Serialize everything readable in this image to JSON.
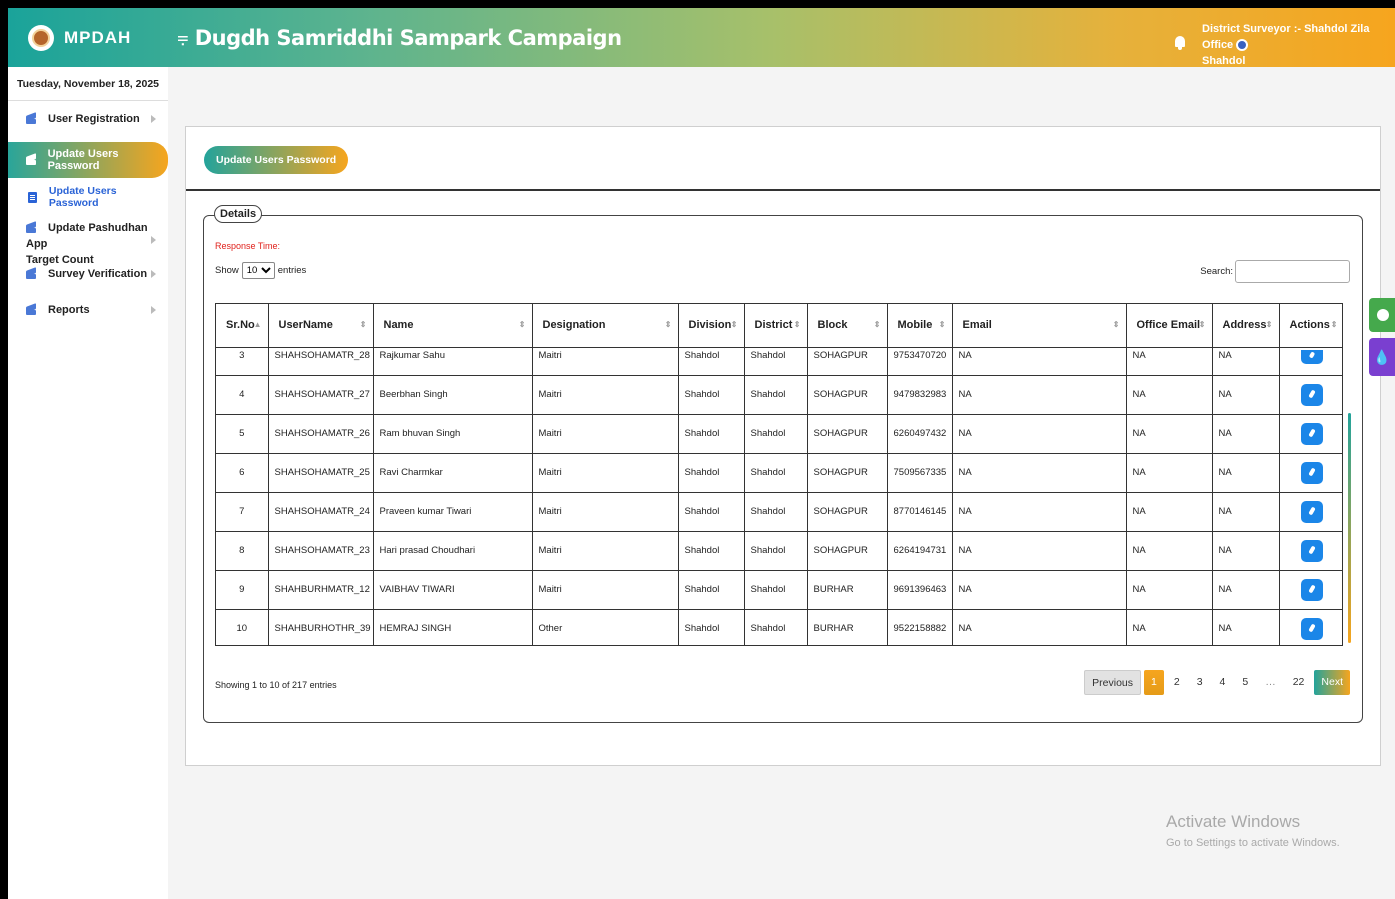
{
  "header": {
    "brand": "MPDAH",
    "menu_icon": "menu-icon",
    "title": "Dugdh Samriddhi Sampark Campaign",
    "user_line1": "District Surveyor :- Shahdol Zila Office",
    "user_line2": "Shahdol"
  },
  "sidebar": {
    "date": "Tuesday, November 18, 2025",
    "items": [
      {
        "label": "User Registration"
      },
      {
        "label": "Update Users Password"
      },
      {
        "label": "Update Users Password"
      },
      {
        "label_line1": "Update Pashudhan App",
        "label_line2": "Target Count"
      },
      {
        "label": "Survey Verification"
      },
      {
        "label": "Reports"
      }
    ]
  },
  "card": {
    "button": "Update Users Password",
    "legend": "Details",
    "response_time": "Response Time:",
    "show_label": "Show",
    "entries_label": "entries",
    "entries_value": "10",
    "search_label": "Search:",
    "search_value": ""
  },
  "table": {
    "headers": [
      "Sr.No",
      "UserName",
      "Name",
      "Designation",
      "Division",
      "District",
      "Block",
      "Mobile",
      "Email",
      "Office Email",
      "Address",
      "Actions"
    ],
    "rows": [
      [
        "3",
        "SHAHSOHAMATR_28",
        "Rajkumar Sahu",
        "Maitri",
        "Shahdol",
        "Shahdol",
        "SOHAGPUR",
        "9753470720",
        "NA",
        "NA",
        "NA"
      ],
      [
        "4",
        "SHAHSOHAMATR_27",
        "Beerbhan Singh",
        "Maitri",
        "Shahdol",
        "Shahdol",
        "SOHAGPUR",
        "9479832983",
        "NA",
        "NA",
        "NA"
      ],
      [
        "5",
        "SHAHSOHAMATR_26",
        "Ram bhuvan Singh",
        "Maitri",
        "Shahdol",
        "Shahdol",
        "SOHAGPUR",
        "6260497432",
        "NA",
        "NA",
        "NA"
      ],
      [
        "6",
        "SHAHSOHAMATR_25",
        "Ravi Charmkar",
        "Maitri",
        "Shahdol",
        "Shahdol",
        "SOHAGPUR",
        "7509567335",
        "NA",
        "NA",
        "NA"
      ],
      [
        "7",
        "SHAHSOHAMATR_24",
        "Praveen kumar Tiwari",
        "Maitri",
        "Shahdol",
        "Shahdol",
        "SOHAGPUR",
        "8770146145",
        "NA",
        "NA",
        "NA"
      ],
      [
        "8",
        "SHAHSOHAMATR_23",
        "Hari prasad Choudhari",
        "Maitri",
        "Shahdol",
        "Shahdol",
        "SOHAGPUR",
        "6264194731",
        "NA",
        "NA",
        "NA"
      ],
      [
        "9",
        "SHAHBURHMATR_12",
        "VAIBHAV TIWARI",
        "Maitri",
        "Shahdol",
        "Shahdol",
        "BURHAR",
        "9691396463",
        "NA",
        "NA",
        "NA"
      ],
      [
        "10",
        "SHAHBURHOTHR_39",
        "HEMRAJ SINGH",
        "Other",
        "Shahdol",
        "Shahdol",
        "BURHAR",
        "9522158882",
        "NA",
        "NA",
        "NA"
      ]
    ],
    "info": "Showing 1 to 10 of 217 entries"
  },
  "pagination": {
    "previous": "Previous",
    "pages": [
      "1",
      "2",
      "3",
      "4",
      "5",
      "…",
      "22"
    ],
    "next": "Next",
    "active": "1"
  },
  "watermark": {
    "line1": "Activate Windows",
    "line2": "Go to Settings to activate Windows."
  },
  "colors": {
    "accent_teal": "#23a39b",
    "accent_orange": "#f6a51e",
    "action_blue": "#1b86e8",
    "response_red": "#e0211c"
  }
}
